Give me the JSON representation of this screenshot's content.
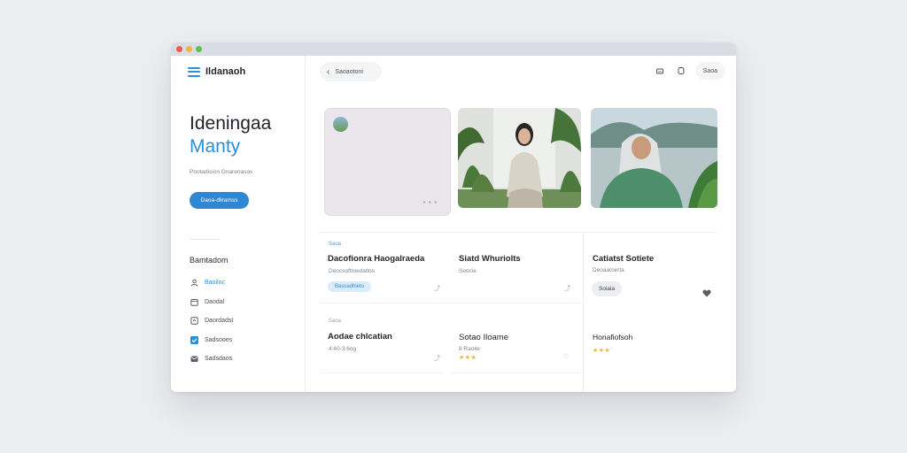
{
  "sidebar": {
    "brand": "Ildanaoh",
    "hero_line1": "Ideningaa",
    "hero_line2": "Manty",
    "subtitle": "Pootadision Gnarenasos",
    "cta_label": "Daoa-dliramss",
    "section_title": "Bamtadom",
    "nav": [
      {
        "label": "Baoiloc",
        "icon": "user-icon",
        "active": true
      },
      {
        "label": "Daodal",
        "icon": "calendar-icon",
        "active": false
      },
      {
        "label": "Daordadst",
        "icon": "bookmark-icon",
        "active": false
      },
      {
        "label": "Sadsooes",
        "icon": "checkbox-icon",
        "active": false
      },
      {
        "label": "Sadsdaos",
        "icon": "mail-icon",
        "active": false
      }
    ]
  },
  "topbar": {
    "back_label": "Saoaotoni",
    "action_label": "Saoa"
  },
  "cards": {
    "row1": [
      {
        "tag": "Saoa",
        "title": "Dacofionra Haogalraeda",
        "sub": "Deocsofttoedatlos",
        "chip": "Bascadhieto"
      },
      {
        "title": "Siatd Whuriolts",
        "sub": "Seocie"
      },
      {
        "title": "Catiatst Sotiete",
        "sub": "Deoaatoerta",
        "chip": "Soiaia"
      }
    ],
    "row2": [
      {
        "tag": "Saoa",
        "title": "Aodae chlcatian",
        "sub": "4:40-3:6og"
      },
      {
        "title": "Sotao Iloame",
        "sub": "8 Raolie",
        "stars": "★★★"
      },
      {
        "title": "Honafiofsoh",
        "stars": "★★★'"
      }
    ]
  },
  "colors": {
    "accent": "#2b8fd6",
    "button": "#2f86d2",
    "star": "#f2b233"
  }
}
